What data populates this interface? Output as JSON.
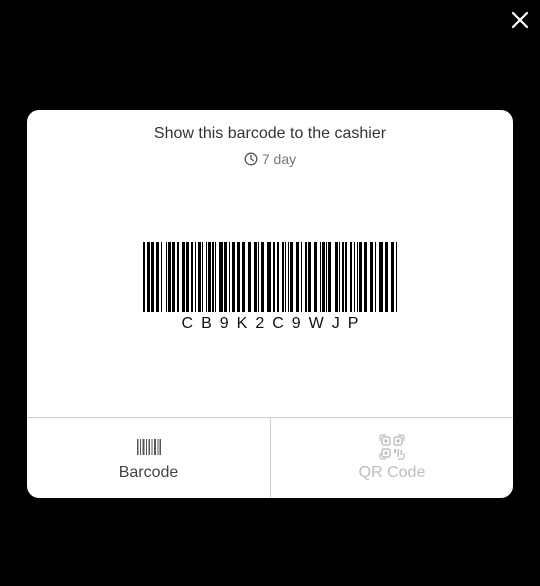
{
  "modal": {
    "title": "Show this barcode to the cashier",
    "validity": "7 day",
    "code": "CB9K2C9WJP"
  },
  "tabs": [
    {
      "label": "Barcode",
      "icon": "barcode-icon",
      "active": true
    },
    {
      "label": "QR Code",
      "icon": "qr-code-icon",
      "active": false
    }
  ],
  "icons": {
    "close": "close-icon",
    "clock": "clock-icon"
  },
  "colors": {
    "background": "#000000",
    "card": "#ffffff",
    "text": "#333333",
    "muted": "#777777",
    "inactive": "#bdbdbd"
  }
}
